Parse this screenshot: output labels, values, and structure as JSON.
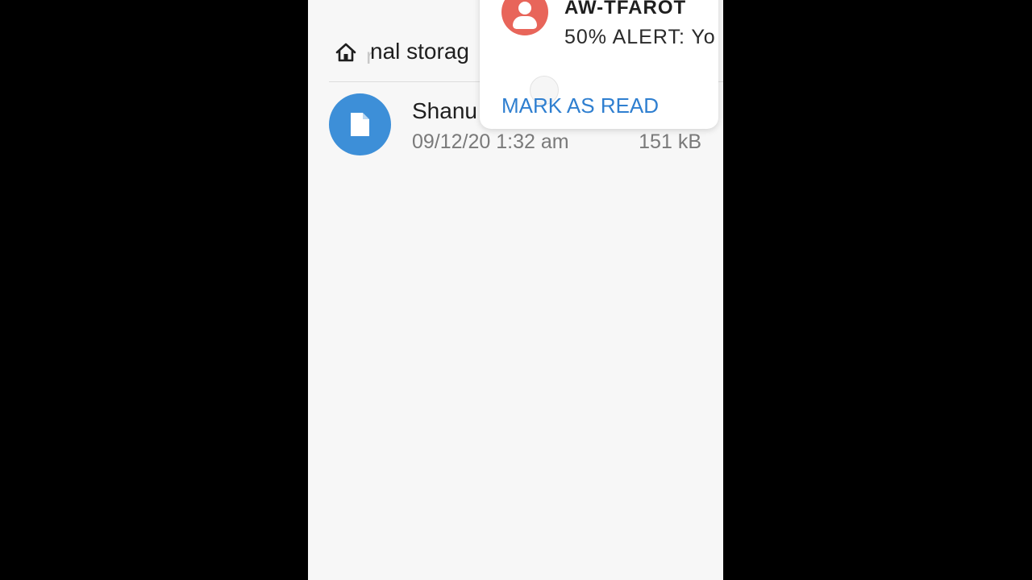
{
  "breadcrumb": {
    "icon": "home-icon",
    "fade_char": "r",
    "path_text": "nal storag"
  },
  "files": [
    {
      "icon": "document-icon",
      "name": "Shanu",
      "date": "09/12/20 1:32 am",
      "size": "151 kB",
      "avatar_color": "#3d8fd8"
    }
  ],
  "notification": {
    "avatar_icon": "person-icon",
    "avatar_color": "#e8655a",
    "sender": "AW-TFAROT",
    "message": "50% ALERT: Yo",
    "action_label": "MARK AS READ",
    "action_color": "#2f7fd0"
  }
}
